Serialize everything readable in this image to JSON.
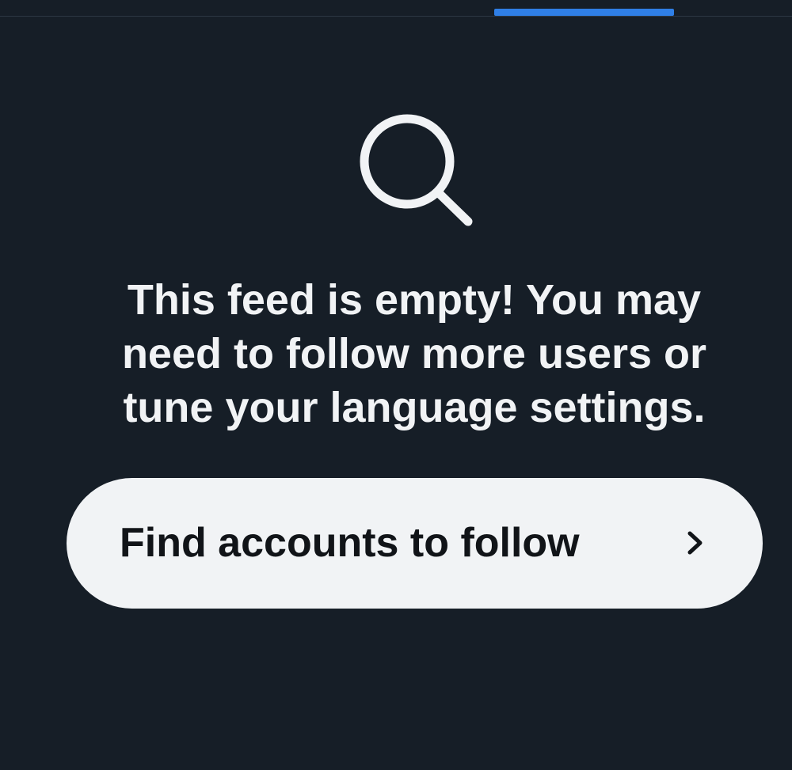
{
  "tabs": {
    "active_indicator_color": "#2f7fe6"
  },
  "empty_state": {
    "icon": "search-icon",
    "message": "This feed is empty! You may need to follow more users or tune your language settings."
  },
  "find_button": {
    "label": "Find accounts to follow",
    "trailing_icon": "chevron-right-icon"
  },
  "colors": {
    "background": "#161e27",
    "text": "#f1f3f5",
    "button_background": "#f1f3f5",
    "button_text": "#111418"
  }
}
